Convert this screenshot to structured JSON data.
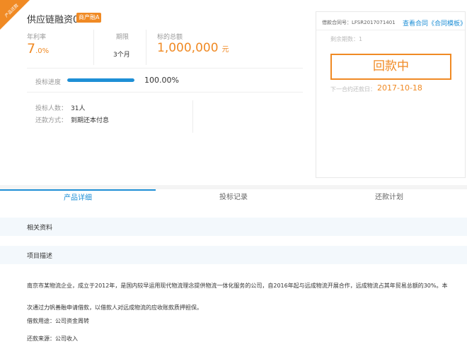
{
  "corner_ribbon": "产品还款",
  "loan": {
    "title": "供应链融资042",
    "tag": "商产融A"
  },
  "stats": [
    {
      "label": "年利率",
      "value_main": "7",
      "value_sub": ".0%"
    },
    {
      "label": "期限",
      "value_main": "3",
      "value_sub": "个月"
    },
    {
      "label": "标的总额",
      "value_main": "1,000,000",
      "value_sub": "元"
    }
  ],
  "progress": {
    "label": "投标进度",
    "percent_text": "100.00%",
    "fraction": 1.0
  },
  "info": {
    "investors_label": "投标人数：",
    "investors_value": "31人",
    "repay_label": "还款方式：",
    "repay_value": "到期还本付息"
  },
  "panel": {
    "contract_label": "借款合同号：LFSR2017071401",
    "contract_link": "查看合同《合同模板》",
    "remaining": "剩余期数：1",
    "status_button": "回款中",
    "next_date_label": "下一合约还款日：",
    "next_date_value": "2017-10-18"
  },
  "tabs": [
    {
      "label": "产品详细",
      "active": true
    },
    {
      "label": "投标记录",
      "active": false
    },
    {
      "label": "还款计划",
      "active": false
    }
  ],
  "sections": {
    "related": "相关资料",
    "description": "项目描述"
  },
  "description": {
    "paragraph": "南京市某物流企业，成立于2012年，是国内较早运用现代物流理念提供物流一体化服务的公司，自2016年起与远成物流开展合作，远成物流占其年贸易总额的30%。本次通过力帆善融申请借款，以借款人对远成物流的应收账款质押担保。",
    "purpose": "借款用途：公司资金周转",
    "repay_source": "还款来源：公司收入"
  },
  "colors": {
    "accent": "#f08a24",
    "primary": "#1e8fd6"
  }
}
